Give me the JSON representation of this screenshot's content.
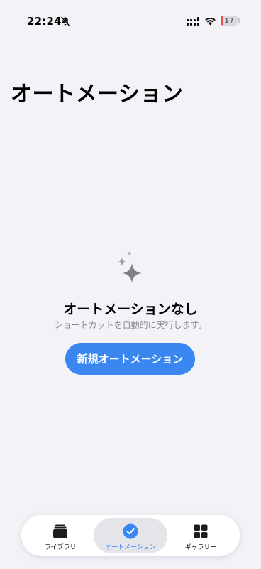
{
  "status_bar": {
    "time": "22:24",
    "battery_level": "17",
    "icons": [
      "bell-slash-icon",
      "signal-icon",
      "wifi-icon",
      "battery-icon"
    ]
  },
  "page": {
    "title": "オートメーション"
  },
  "empty_state": {
    "icon": "sparkles-icon",
    "title": "オートメーションなし",
    "subtitle": "ショートカットを自動的に実行します。",
    "button_label": "新規オートメーション"
  },
  "tab_bar": {
    "selected": "オートメーション",
    "tabs": [
      {
        "label": "ライブラリ",
        "icon": "library-stack-icon"
      },
      {
        "label": "オートメーション",
        "icon": "checkmark-circle-icon"
      },
      {
        "label": "ギャラリー",
        "icon": "grid-icon"
      }
    ]
  },
  "colors": {
    "background": "#f2f2f7",
    "accent": "#3a87f2",
    "secondary_text": "#8a8a8e",
    "battery_low": "#e6514a"
  }
}
